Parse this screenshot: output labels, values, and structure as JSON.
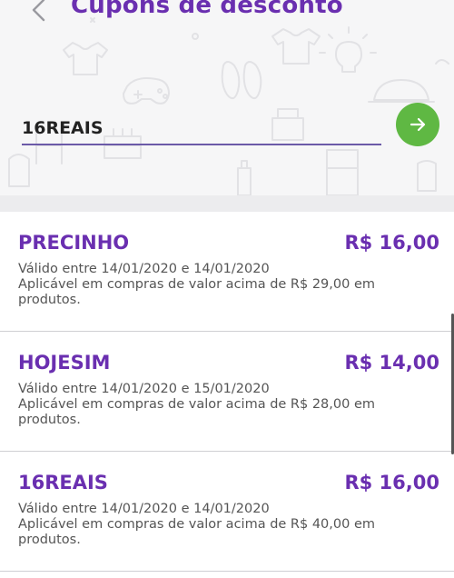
{
  "header": {
    "title": "Cupons de desconto",
    "back_icon": "chevron-left-icon"
  },
  "coupon_entry": {
    "value": "16REAIS",
    "submit_icon": "arrow-right-icon",
    "submit_color": "#5fb843"
  },
  "colors": {
    "accent": "#6a2fb0"
  },
  "coupons": [
    {
      "code": "PRECINHO",
      "value": "R$ 16,00",
      "validity": "Válido entre 14/01/2020 e 14/01/2020",
      "condition": "Aplicável em compras de valor acima de R$ 29,00 em produtos."
    },
    {
      "code": "HOJESIM",
      "value": "R$ 14,00",
      "validity": "Válido entre 14/01/2020 e 15/01/2020",
      "condition": "Aplicável em compras de valor acima de R$ 28,00 em produtos."
    },
    {
      "code": "16REAIS",
      "value": "R$ 16,00",
      "validity": "Válido entre 14/01/2020 e 14/01/2020",
      "condition": "Aplicável em compras de valor acima de R$ 40,00 em produtos."
    }
  ]
}
